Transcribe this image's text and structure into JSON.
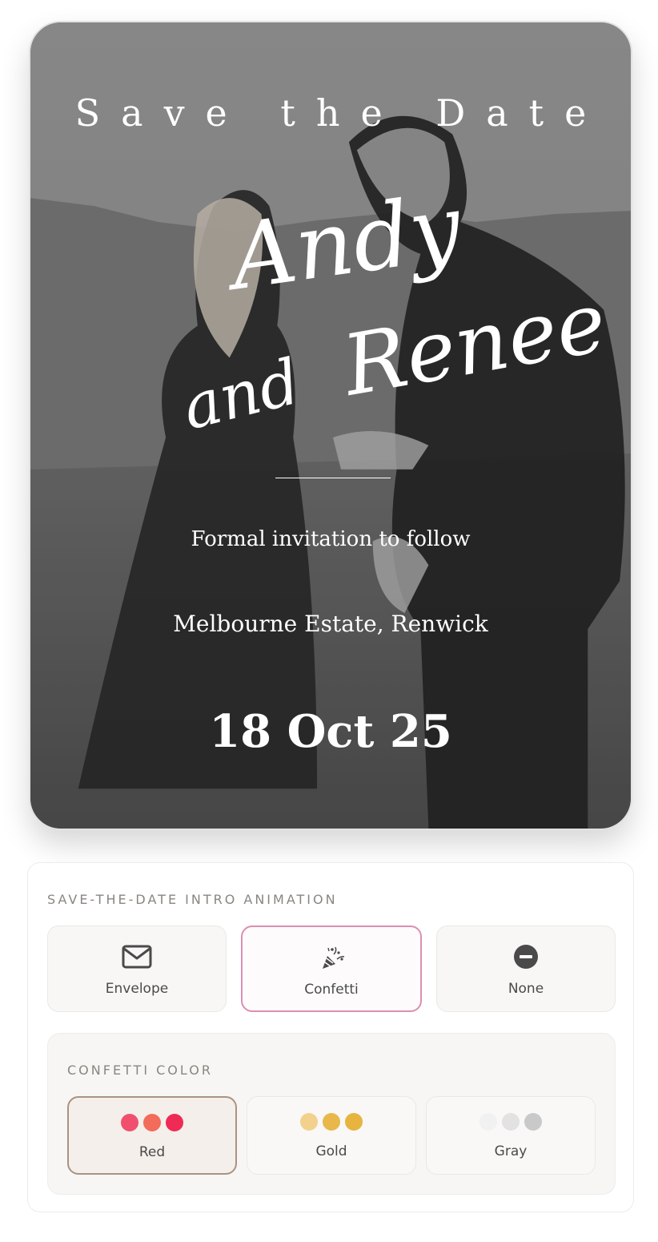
{
  "invitation": {
    "heading": "Save the Date",
    "name_1": "Andy",
    "connector": "and",
    "name_2": "Renee",
    "note": "Formal invitation to follow",
    "venue": "Melbourne Estate, Renwick",
    "date": "18 Oct 25"
  },
  "animation": {
    "section_label": "SAVE-THE-DATE INTRO ANIMATION",
    "selected": "Confetti",
    "options": [
      {
        "label": "Envelope",
        "icon": "envelope-icon"
      },
      {
        "label": "Confetti",
        "icon": "party-popper-icon"
      },
      {
        "label": "None",
        "icon": "no-entry-icon"
      }
    ]
  },
  "confetti_color": {
    "section_label": "CONFETTI COLOR",
    "selected": "Red",
    "options": [
      {
        "label": "Red",
        "colors": [
          "#f0506e",
          "#f26b5b",
          "#ee2a55"
        ]
      },
      {
        "label": "Gold",
        "colors": [
          "#f2d18c",
          "#e8b84a",
          "#e6b43f"
        ]
      },
      {
        "label": "Gray",
        "colors": [
          "#f1f1f1",
          "#e2e2e2",
          "#c9c9c9"
        ]
      }
    ]
  },
  "colors": {
    "selected_animation_border": "#dc8fb3",
    "selected_color_border": "#a99383"
  }
}
